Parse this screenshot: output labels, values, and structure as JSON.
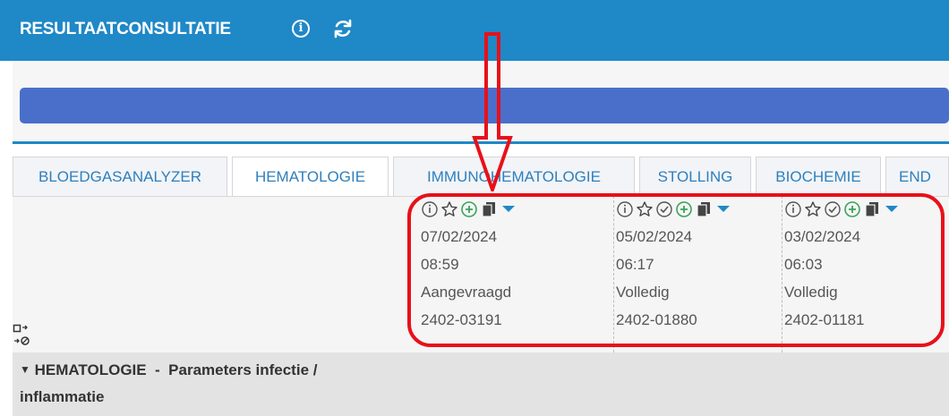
{
  "header": {
    "title": "RESULTAATCONSULTATIE",
    "info_icon": "info-icon",
    "refresh_icon": "refresh-icon"
  },
  "tabs": [
    {
      "label": "BLOEDGASANALYZER",
      "active": false
    },
    {
      "label": "HEMATOLOGIE",
      "active": true
    },
    {
      "label": "IMMUNOHEMATOLOGIE",
      "active": false
    },
    {
      "label": "STOLLING",
      "active": false
    },
    {
      "label": "BIOCHEMIE",
      "active": false
    },
    {
      "label": "END",
      "active": false
    }
  ],
  "result_columns": [
    {
      "date": "07/02/2024",
      "time": "08:59",
      "status": "Aangevraagd",
      "id": "2402-03191",
      "icons": [
        "info-icon",
        "star-icon",
        "plus-circle-icon",
        "copy-icon",
        "dropdown-icon"
      ]
    },
    {
      "date": "05/02/2024",
      "time": "06:17",
      "status": "Volledig",
      "id": "2402-01880",
      "icons": [
        "info-icon",
        "star-icon",
        "check-circle-icon",
        "plus-circle-icon",
        "copy-icon",
        "dropdown-icon"
      ]
    },
    {
      "date": "03/02/2024",
      "time": "06:03",
      "status": "Volledig",
      "id": "2402-01181",
      "icons": [
        "info-icon",
        "star-icon",
        "check-circle-icon",
        "plus-circle-icon",
        "copy-icon",
        "dropdown-icon"
      ]
    }
  ],
  "section": {
    "title_line1": "HEMATOLOGIE  -  Parameters infectie /",
    "title_line2": "inflammatie"
  },
  "colors": {
    "header_bg": "#1f88c7",
    "primary_bar": "#4a6fcb",
    "tab_text": "#2e7fbd",
    "highlight": "#e8101a",
    "plus_green": "#3aa35a"
  }
}
